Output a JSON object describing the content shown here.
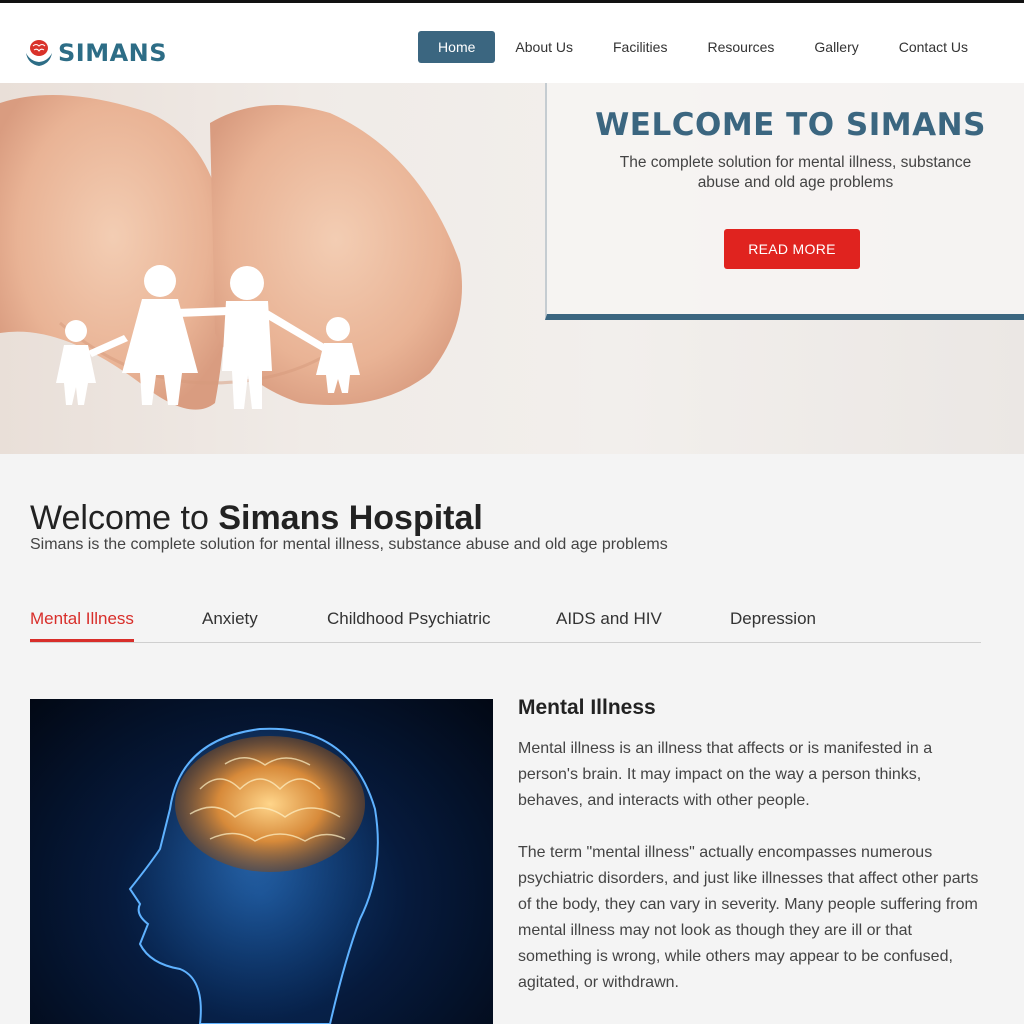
{
  "brand": {
    "name": "SIMANS",
    "primary_color": "#3b6680",
    "accent_color": "#e0231f"
  },
  "nav": {
    "items": [
      {
        "label": "Home",
        "active": true
      },
      {
        "label": "About Us"
      },
      {
        "label": "Facilities"
      },
      {
        "label": "Resources"
      },
      {
        "label": "Gallery"
      },
      {
        "label": "Contact Us"
      }
    ]
  },
  "hero": {
    "title": "WELCOME TO SIMANS",
    "subtitle": "The complete solution for mental illness, substance abuse and old age problems",
    "button_label": "READ MORE",
    "image_icon": "hands-holding-family-icon"
  },
  "intro": {
    "title_plain": "Welcome to ",
    "title_bold": "Simans Hospital",
    "subtitle": "Simans is the complete solution for mental illness, substance abuse and old age problems"
  },
  "tabs": [
    {
      "label": "Mental Illness",
      "active": true
    },
    {
      "label": "Anxiety"
    },
    {
      "label": "Childhood Psychiatric"
    },
    {
      "label": "AIDS and HIV"
    },
    {
      "label": "Depression"
    }
  ],
  "article": {
    "image_icon": "glowing-brain-head-icon",
    "heading": "Mental Illness",
    "paragraph_1": "Mental illness is an illness that affects or is manifested in a person's brain. It may impact on the way a person thinks, behaves, and interacts with other people.",
    "paragraph_2": "The term \"mental illness\" actually encompasses numerous psychiatric disorders, and just like illnesses that affect other parts of the body, they can vary in severity. Many people suffering from mental illness may not look as though they are ill or that something is wrong, while others may appear to be confused, agitated, or withdrawn."
  }
}
